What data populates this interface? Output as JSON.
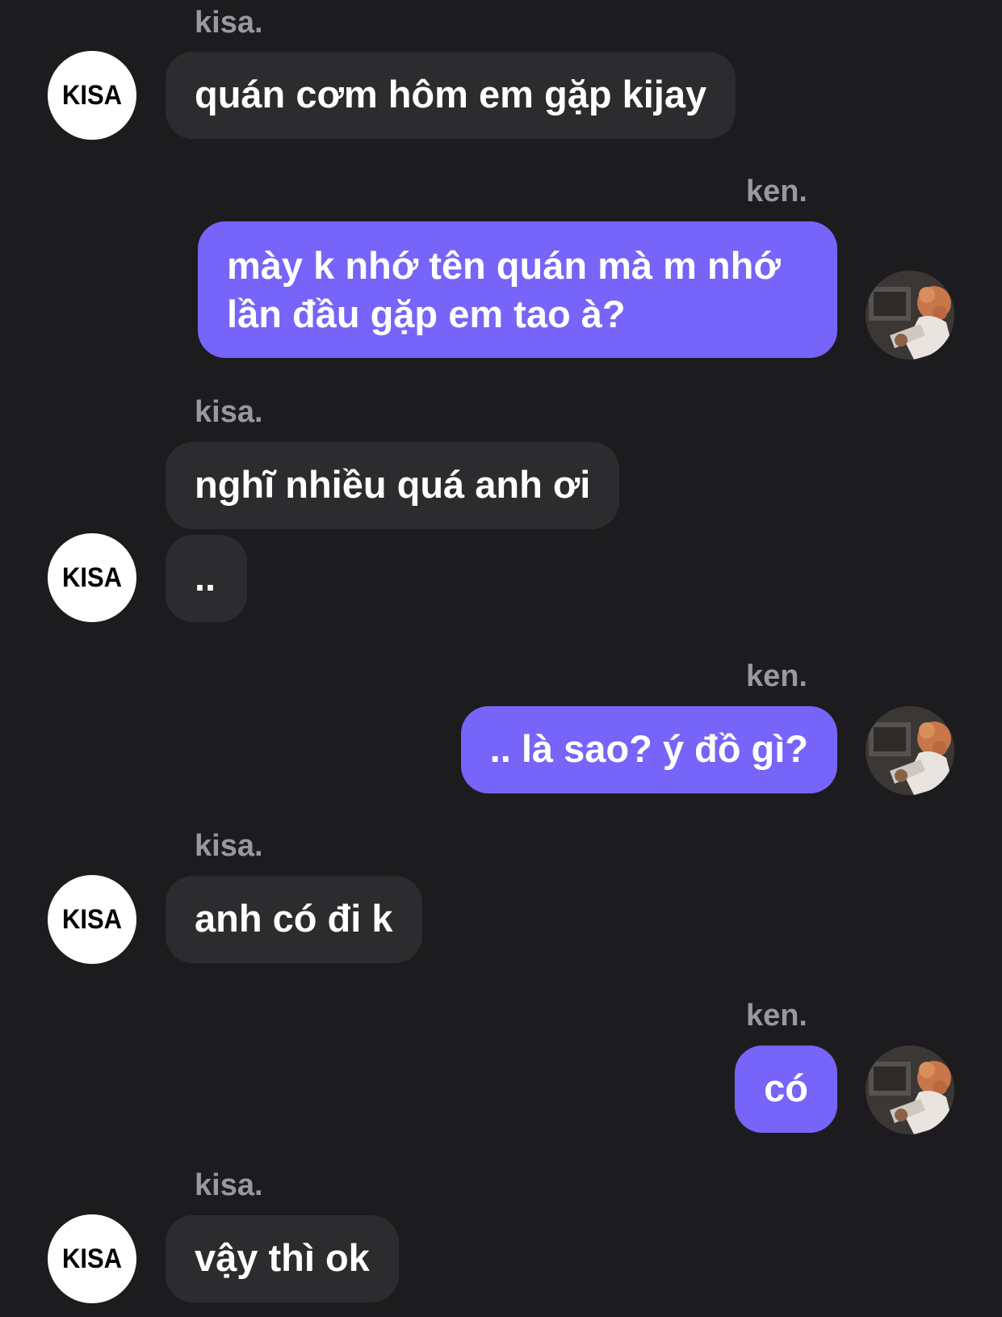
{
  "avatars": {
    "kisa_logo_text": "KISA"
  },
  "colors": {
    "background": "#1c1c1e",
    "incoming_bubble": "#2c2c2e",
    "outgoing_bubble": "#7665f8",
    "sender_name": "#98989f"
  },
  "messages": [
    {
      "sender": "kisa.",
      "direction": "incoming",
      "text": "quán cơm hôm em gặp kijay"
    },
    {
      "sender": "ken.",
      "direction": "outgoing",
      "text": "mày k nhớ tên quán mà m nhớ lần đầu gặp em tao à?"
    },
    {
      "sender": "kisa.",
      "direction": "incoming",
      "text": "nghĩ nhiều quá anh ơi"
    },
    {
      "sender": "",
      "direction": "incoming",
      "text": ".."
    },
    {
      "sender": "ken.",
      "direction": "outgoing",
      "text": ".. là sao? ý đồ gì?"
    },
    {
      "sender": "kisa.",
      "direction": "incoming",
      "text": "anh có đi k"
    },
    {
      "sender": "ken.",
      "direction": "outgoing",
      "text": "có"
    },
    {
      "sender": "kisa.",
      "direction": "incoming",
      "text": "vậy thì ok"
    }
  ]
}
